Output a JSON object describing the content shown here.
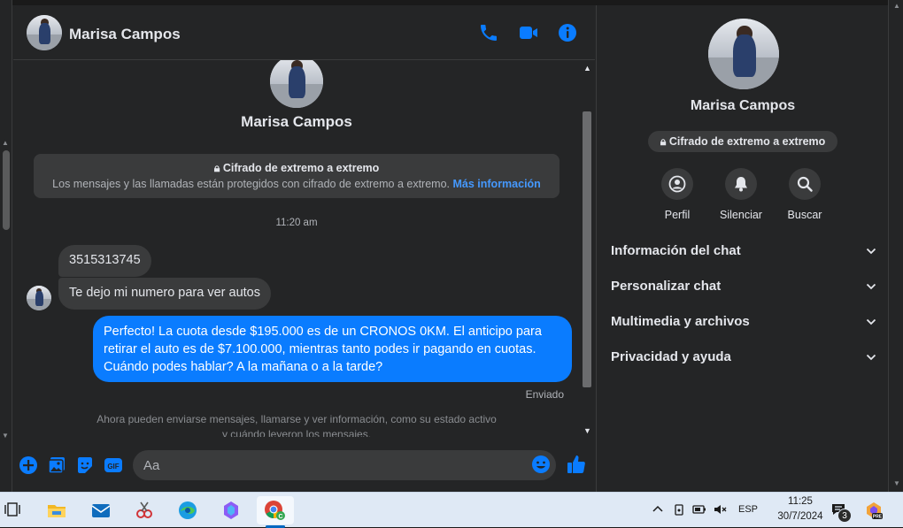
{
  "chat": {
    "header_name": "Marisa Campos",
    "profile_name": "Marisa Campos",
    "e2e_title": "Cifrado de extremo a extremo",
    "e2e_text": "Los mensajes y las llamadas están protegidos con cifrado de extremo a extremo.",
    "e2e_link": "Más información",
    "time_separator": "11:20 am",
    "messages": [
      {
        "direction": "incoming",
        "text": "3515313745"
      },
      {
        "direction": "incoming",
        "text": "Te dejo mi numero para ver autos"
      },
      {
        "direction": "outgoing",
        "text": "Perfecto! La cuota desde $195.000 es de un CRONOS 0KM. El anticipo para retirar el auto es de $7.100.000, mientras tanto podes ir pagando en cuotas. Cuándo podes hablar? A la mañana o a la tarde?"
      }
    ],
    "sent_status": "Enviado",
    "notice": "Ahora pueden enviarse mensajes, llamarse y ver información, como su estado activo y cuándo leyeron los mensajes.",
    "input_placeholder": "Aa"
  },
  "info_panel": {
    "name": "Marisa Campos",
    "e2e_label": "Cifrado de extremo a extremo",
    "actions": [
      {
        "label": "Perfil",
        "icon": "profile-icon"
      },
      {
        "label": "Silenciar",
        "icon": "bell-icon"
      },
      {
        "label": "Buscar",
        "icon": "search-icon"
      }
    ],
    "sections": [
      {
        "title": "Información del chat"
      },
      {
        "title": "Personalizar chat"
      },
      {
        "title": "Multimedia y archivos"
      },
      {
        "title": "Privacidad y ayuda"
      }
    ]
  },
  "taskbar": {
    "apps": [
      "task-view-icon",
      "file-explorer-icon",
      "mail-icon",
      "snipping-tool-icon",
      "edge-icon",
      "copilot-icon",
      "chrome-icon"
    ],
    "language": "ESP",
    "time": "11:25",
    "date": "30/7/2024",
    "notification_count": "3"
  },
  "colors": {
    "background": "#242526",
    "bubble_incoming": "#3a3b3c",
    "bubble_outgoing": "#0a7cff",
    "accent": "#0a7cff",
    "link": "#4599ff",
    "text_primary": "#e4e6eb",
    "text_secondary": "#b0b3b8",
    "taskbar": "#dfe9f5"
  }
}
